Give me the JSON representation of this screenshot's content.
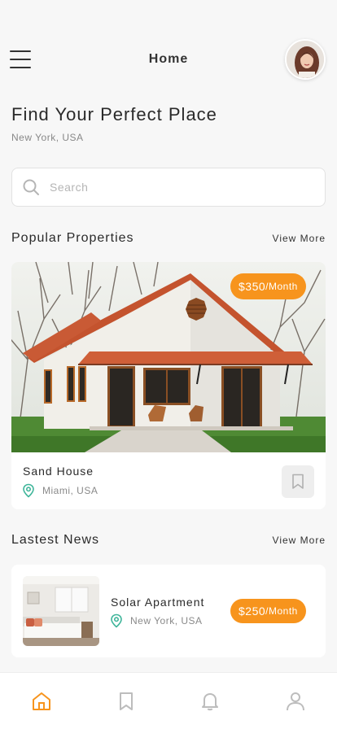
{
  "header": {
    "title": "Home",
    "menu_icon": "hamburger-menu-icon",
    "avatar": "user-avatar"
  },
  "hero": {
    "title": "Find Your Perfect Place",
    "location": "New York, USA"
  },
  "search": {
    "placeholder": "Search",
    "value": "",
    "icon": "search-icon"
  },
  "popular": {
    "title": "Popular Properties",
    "view_more": "View More",
    "card": {
      "name": "Sand House",
      "location": "Miami, USA",
      "price": "$350",
      "price_unit": "/Month",
      "bookmark_icon": "bookmark-icon"
    }
  },
  "news": {
    "title": "Lastest News",
    "view_more": "View More",
    "card": {
      "name": "Solar Apartment",
      "location": "New York, USA",
      "price": "$250",
      "price_unit": "/Month"
    }
  },
  "tabbar": {
    "items": [
      "home-icon",
      "bookmark-icon",
      "bell-icon",
      "user-icon"
    ],
    "active_color": "#f7941d",
    "inactive_color": "#bdbdbd"
  },
  "colors": {
    "accent": "#f7941d",
    "location_pin": "#3fb59a",
    "background": "#f7f7f7"
  }
}
